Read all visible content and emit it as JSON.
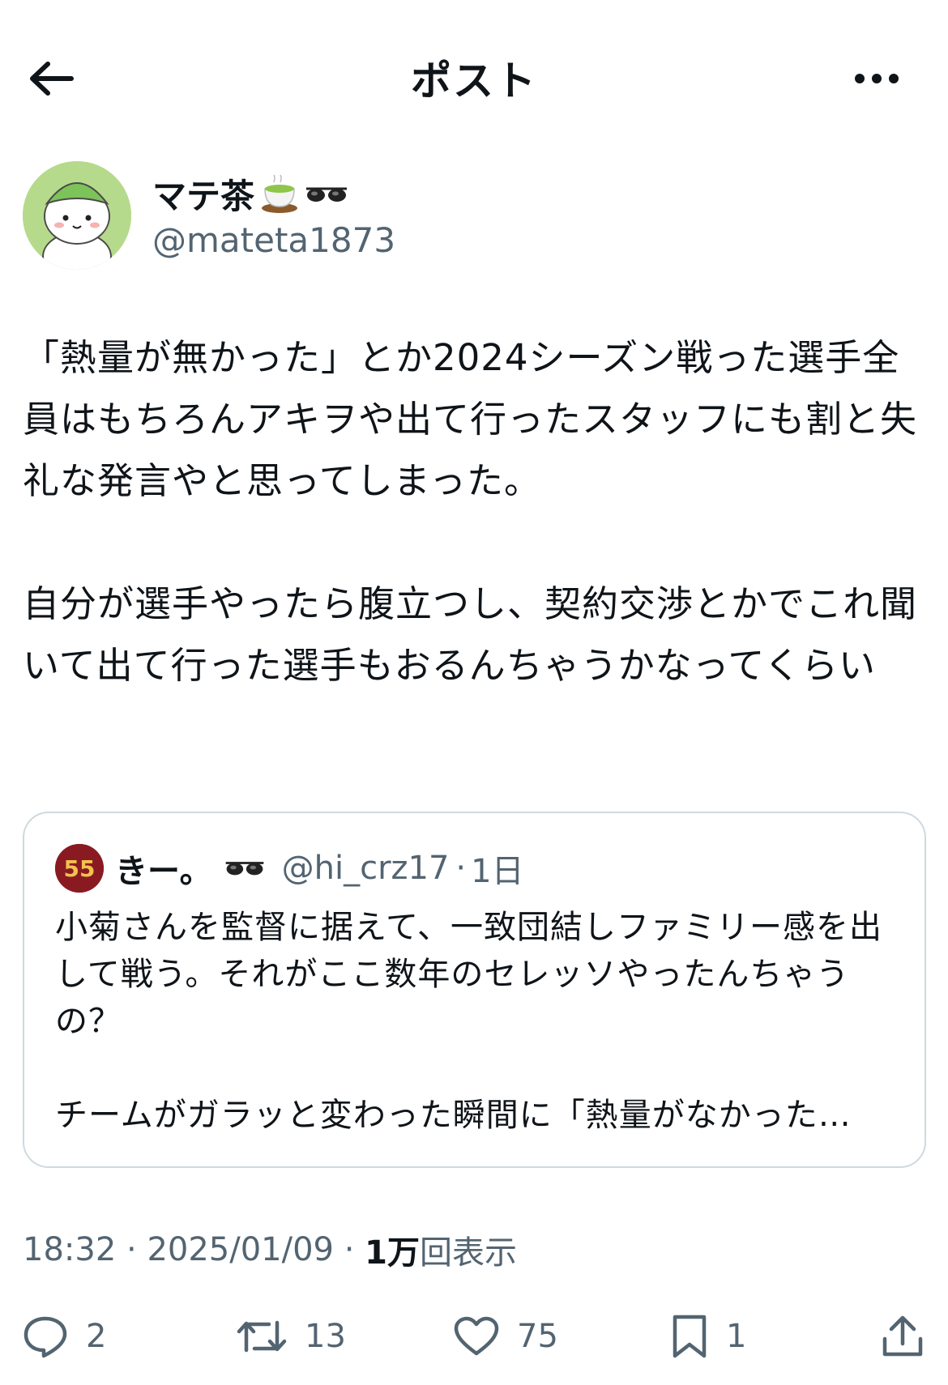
{
  "header": {
    "title": "ポスト"
  },
  "author": {
    "display_name": "マテ茶",
    "handle": "@mateta1873",
    "name_emojis": [
      "tea-cup-emoji",
      "glasses-emoji"
    ]
  },
  "post": {
    "text": "「熱量が無かった」とか2024シーズン戦った選手全員はもちろんアキヲや出て行ったスタッフにも割と失礼な発言やと思ってしまった。\n\n自分が選手やったら腹立つし、契約交渉とかでこれ聞いて出て行った選手もおるんちゃうかなってくらい"
  },
  "quote": {
    "display_name": "きー。",
    "handle": "@hi_crz17",
    "separator": "·",
    "time": "1日",
    "avatar_number": "55",
    "text": "小菊さんを監督に据えて、一致団結しファミリー感を出して戦う。それがここ数年のセレッソやったんちゃうの？\n\nチームがガラッと変わった瞬間に「熱量がなかった…"
  },
  "meta": {
    "time": "18:32",
    "sep1": " · ",
    "date": "2025/01/09",
    "sep2": " · ",
    "views_number": "1万",
    "views_label": "回表示"
  },
  "actions": {
    "replies": "2",
    "reposts": "13",
    "likes": "75",
    "bookmarks": "1"
  },
  "colors": {
    "text": "#0f1419",
    "secondary": "#536471",
    "border": "#cfd9de",
    "avatar_bg": "#b6da8c"
  }
}
